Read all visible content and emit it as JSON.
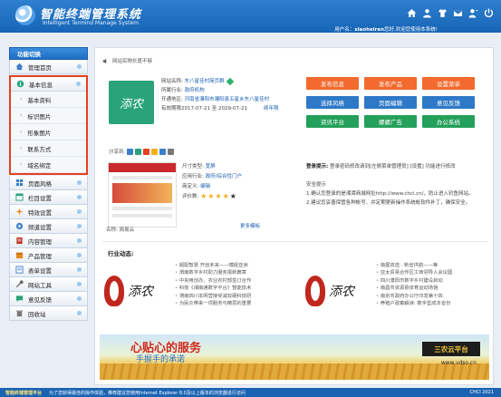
{
  "header": {
    "title": "智能终端管理系统",
    "subtitle": "Intelligent Termind Manage System",
    "welcome_prefix": "用户名：",
    "username": "xiaoheiren",
    "welcome_suffix": "您好,欢迎您使用本系统!",
    "icons": [
      "home-icon",
      "user-icon",
      "shirt-icon",
      "mail-icon",
      "user-alt-icon",
      "power-icon"
    ]
  },
  "sidebar": {
    "heading": "功能切换",
    "items_top": [
      {
        "label": "管理首页"
      }
    ],
    "group": {
      "label": "基本信息",
      "subitems": [
        "基本资料",
        "标识图片",
        "形象图片",
        "联系方式",
        "域名绑定"
      ]
    },
    "items_bottom": [
      {
        "label": "页面风格"
      },
      {
        "label": "栏目设置"
      },
      {
        "label": "特效设置"
      },
      {
        "label": "频道设置"
      },
      {
        "label": "内容管理"
      },
      {
        "label": "产品管理"
      },
      {
        "label": "表单设置"
      },
      {
        "label": "网站工具"
      },
      {
        "label": "意见反馈"
      },
      {
        "label": "回收站"
      }
    ]
  },
  "main": {
    "notice": "网站实物长度不够",
    "store": {
      "logo_text": "添农",
      "site_name_label": "网站名称:",
      "site_name": "东八星佳村简页群",
      "region_label": "所属行业:",
      "region": "政府机构",
      "area_label": "开通地区:",
      "area": "河南省濮阳市濮阳县五星乡东八星佳村",
      "valid_label": "有效期限",
      "valid": "2017-07-21 至 2029-07-21",
      "renew": "续年限",
      "share_label": "分享到:"
    },
    "buttons": [
      {
        "label": "发布信息",
        "color": "orange"
      },
      {
        "label": "发布产品",
        "color": "orange"
      },
      {
        "label": "设置菜单",
        "color": "orange"
      },
      {
        "label": "选择风格",
        "color": "blue"
      },
      {
        "label": "页面编辑",
        "color": "blue"
      },
      {
        "label": "意见反馈",
        "color": "blue"
      },
      {
        "label": "资讯平台",
        "color": "green"
      },
      {
        "label": "螺螺广告",
        "color": "green"
      },
      {
        "label": "办公系统",
        "color": "green"
      }
    ],
    "template": {
      "size_label": "尺寸类型:",
      "size": "宽屏",
      "industry_label": "应用行业:",
      "industry": "政府/综合性门户",
      "style_label": "商定义:",
      "style": "编辑",
      "rating_label": "评价数:",
      "rating": 4,
      "rating_max": 5,
      "name_label": "名称:",
      "name": "简易云",
      "more": "更多模板"
    },
    "login_note": {
      "label": "登录提示:",
      "text": "登录密码修改请到[左侧菜单管理员] [设置] 功能进行修改"
    },
    "tips": {
      "title": "安全提示",
      "lines": [
        "1.确认您登录的是湘潭商城网址http://www.chci.cn/，防止进入钓鱼网站。",
        "2.建议您妥善保管各种帐号、并定期更新操作系统帐软件补丁，确保安全。"
      ]
    },
    "news": {
      "title": "行业动态:",
      "left_logo": "添农",
      "right_logo": "添农",
      "left_items": [
        "超配智慧 开创未来——幢挺亚洲",
        "渭南数字乡村助力服务报新篇章",
        "中央用创办、农业农村部签订合作",
        "科技《湘南通数字平台》智能技术",
        "渭南四川本网营接受减双硬科技研",
        "为民众带来一项服务与精思的重要"
      ],
      "right_items": [
        "南屋双选 · 新省供航——等",
        "亚太贸易合作区工商领导人会议圆",
        "四川濮阳市数字乡村建设启动",
        "南昌市资源县体育运动场馆",
        "南京市政府办公厅印发第十四",
        "养殖户政策解读: 数字型成本省份"
      ]
    },
    "banner": {
      "slogan1": "心贴心的服务",
      "slogan2": "手握手的承诺",
      "brand": "三农云平台",
      "url": "www.vdso.cn"
    }
  },
  "footer": {
    "brand": "智能终端管理平台",
    "text": "为了您获得最佳的操作体验，推荐建议您使用Internet Explorer 8.0及以上版本的浏览器进行访问",
    "right": "CHCI 2021"
  },
  "colors": {
    "header": "#1765b6",
    "orange": "#f26a2e",
    "blue": "#2d79c7",
    "green": "#24a05a",
    "highlight": "#e4411f"
  }
}
